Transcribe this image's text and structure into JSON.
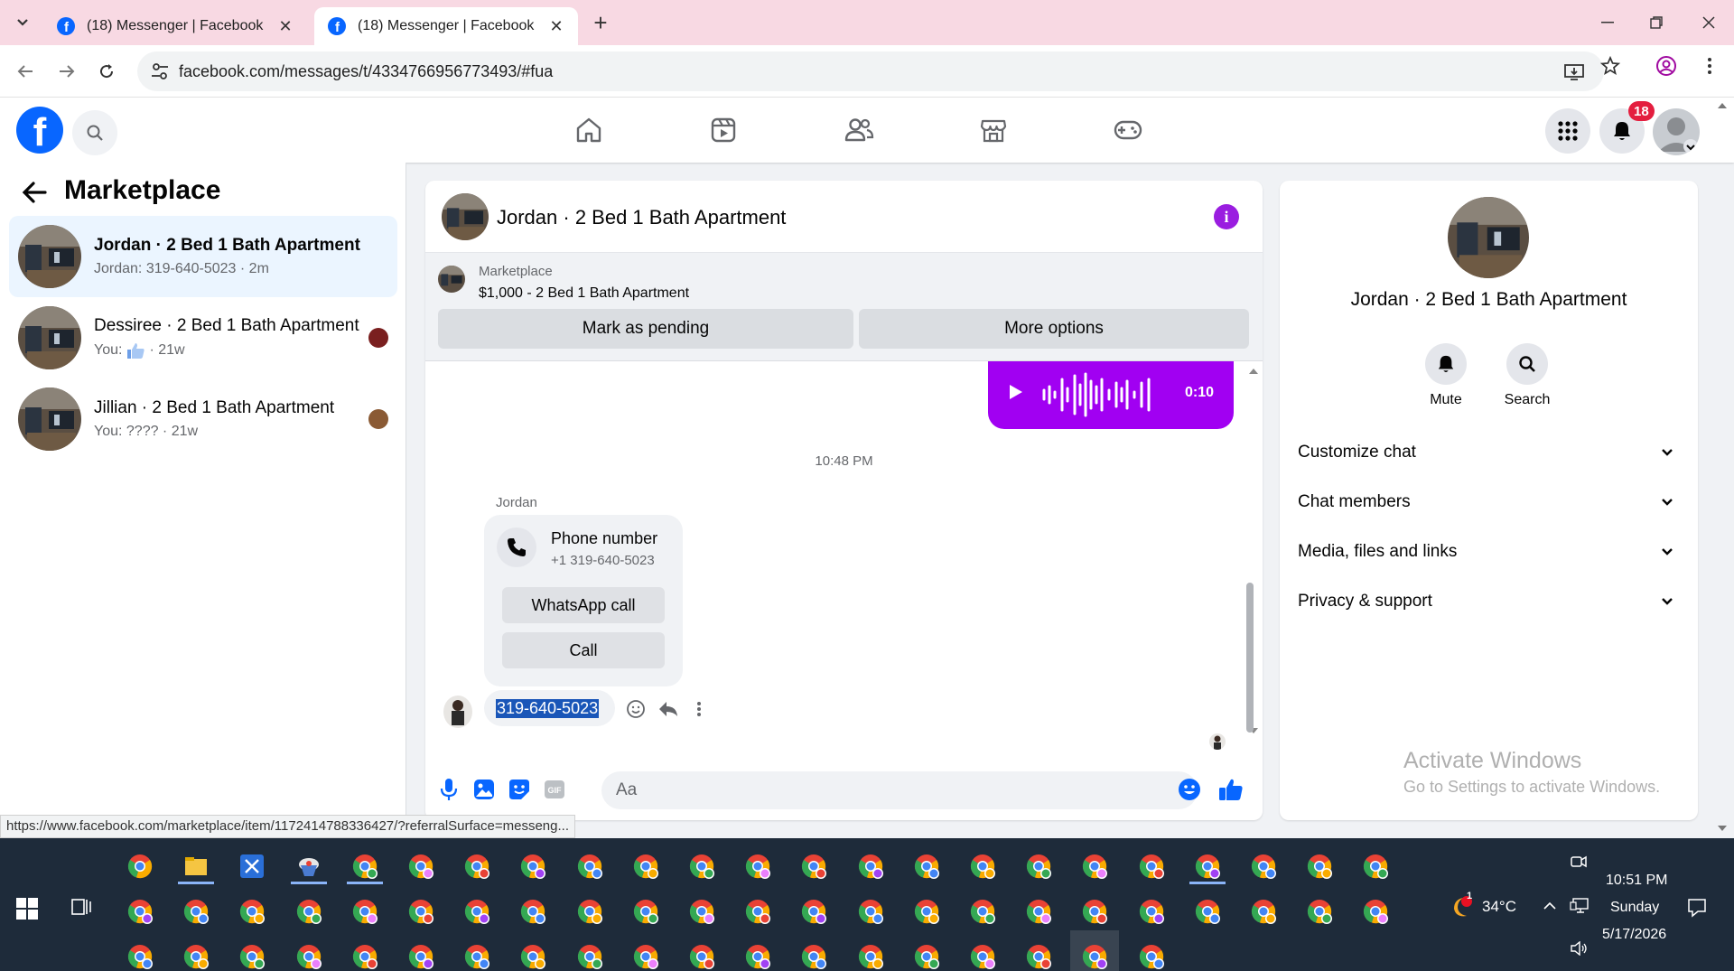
{
  "browser": {
    "tabs": [
      {
        "title": "(18) Messenger | Facebook",
        "active": false
      },
      {
        "title": "(18) Messenger | Facebook",
        "active": true
      }
    ],
    "url": "facebook.com/messages/t/4334766956773493/#fua",
    "status_url": "https://www.facebook.com/marketplace/item/1172414788336427/?referralSurface=messeng..."
  },
  "fb": {
    "notification_count": "18",
    "logo_letter": "f"
  },
  "left": {
    "title": "Marketplace",
    "conversations": [
      {
        "name": "Jordan · 2 Bed 1 Bath Apartment",
        "preview": "Jordan: 319-640-5023 · 2m",
        "active": true
      },
      {
        "name": "Dessiree · 2 Bed 1 Bath Apartment",
        "preview": "You:",
        "time": "· 21w",
        "active": false
      },
      {
        "name": "Jillian · 2 Bed 1 Bath Apartment",
        "preview": "You: ???? · 21w",
        "active": false
      }
    ]
  },
  "chat": {
    "title": "Jordan · 2 Bed 1 Bath Apartment",
    "marketplace_label": "Marketplace",
    "listing": "$1,000 - 2 Bed 1 Bath Apartment",
    "mark_pending": "Mark as pending",
    "more_options": "More options",
    "voice_duration": "0:10",
    "timestamp": "10:48 PM",
    "sender": "Jordan",
    "phone_card": {
      "title": "Phone number",
      "number": "+1 319-640-5023",
      "whatsapp": "WhatsApp call",
      "call": "Call"
    },
    "message": "319-640-5023",
    "composer_placeholder": "Aa"
  },
  "right": {
    "name": "Jordan · 2 Bed 1 Bath Apartment",
    "mute": "Mute",
    "search": "Search",
    "sections": [
      "Customize chat",
      "Chat members",
      "Media, files and links",
      "Privacy & support"
    ],
    "activate_title": "Activate Windows",
    "activate_sub": "Go to Settings to activate Windows."
  },
  "taskbar": {
    "weather": "34°C",
    "weather_badge": "1",
    "time": "10:51 PM",
    "day": "Sunday",
    "date": "5/17/2026"
  },
  "colors": {
    "fb_blue": "#0866ff",
    "messenger_purple": "#a100f2",
    "tab_strip": "#f8d9e3",
    "active_conv": "#ebf5ff",
    "taskbar": "#1e2b3a"
  }
}
